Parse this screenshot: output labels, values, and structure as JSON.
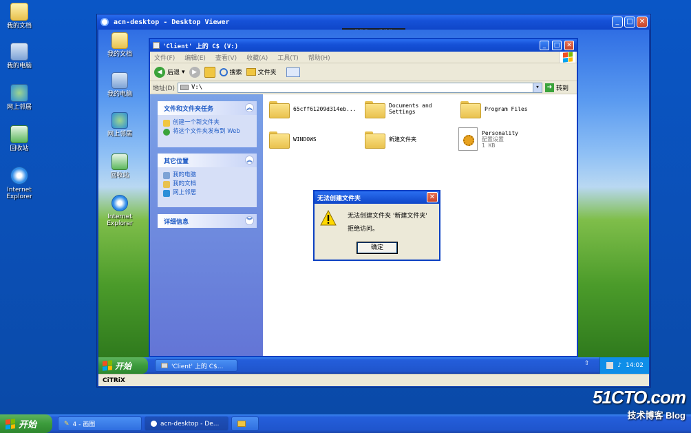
{
  "outer_desktop": {
    "icons": [
      {
        "label": "我的文档",
        "icon": "my-documents-icon"
      },
      {
        "label": "我的电脑",
        "icon": "my-computer-icon"
      },
      {
        "label": "网上邻居",
        "icon": "network-places-icon"
      },
      {
        "label": "回收站",
        "icon": "recycle-bin-icon"
      },
      {
        "label": "Internet Explorer",
        "icon": "internet-explorer-icon"
      }
    ]
  },
  "outer_taskbar": {
    "start_label": "开始",
    "tasks": [
      "4 - 画图",
      "acn-desktop - De..."
    ],
    "colors": {
      "taskbar": "#245edb",
      "start": "#3c9b3c"
    }
  },
  "viewer": {
    "title": "acn-desktop - Desktop Viewer",
    "handle_label": "⠿⠿⠿ ↓ ⠿⠿⠿",
    "buttons": {
      "minimize": "_",
      "maximize": "□",
      "close": "✕"
    }
  },
  "inner_desktop": {
    "icons": [
      {
        "label": "我的文档",
        "icon": "my-documents-icon"
      },
      {
        "label": "我的电脑",
        "icon": "my-computer-icon"
      },
      {
        "label": "网上邻居",
        "icon": "network-places-icon"
      },
      {
        "label": "回收站",
        "icon": "recycle-bin-icon"
      },
      {
        "label": "Internet Explorer",
        "icon": "internet-explorer-icon"
      }
    ]
  },
  "explorer": {
    "title": "'Client' 上的 C$ (V:)",
    "menus": [
      "文件(F)",
      "编辑(E)",
      "查看(V)",
      "收藏(A)",
      "工具(T)",
      "帮助(H)"
    ],
    "toolbar": {
      "back": "后退",
      "search": "搜索",
      "folders": "文件夹"
    },
    "address": {
      "label": "地址(D)",
      "value": "V:\\",
      "go": "转到"
    },
    "task_pane": {
      "file_tasks": {
        "title": "文件和文件夹任务",
        "links": [
          "创建一个新文件夹",
          "将这个文件夹发布到 Web"
        ]
      },
      "other_places": {
        "title": "其它位置",
        "links": [
          "我的电脑",
          "我的文档",
          "网上邻居"
        ]
      },
      "details": {
        "title": "详细信息"
      }
    },
    "files": [
      {
        "name": "65cff61209d314eb...",
        "type": "folder"
      },
      {
        "name": "Documents and Settings",
        "type": "folder"
      },
      {
        "name": "Program Files",
        "type": "folder"
      },
      {
        "name": "WINDOWS",
        "type": "folder"
      },
      {
        "name": "新建文件夹",
        "type": "folder"
      },
      {
        "name": "Personality",
        "sub1": "配置设置",
        "sub2": "1 KB",
        "type": "config"
      }
    ]
  },
  "dialog": {
    "title": "无法创建文件夹",
    "message_line1": "无法创建文件夹 '新建文件夹'",
    "message_line2": "拒绝访问。",
    "ok_label": "确定"
  },
  "inner_taskbar": {
    "start_label": "开始",
    "task": "'Client' 上的 C$...",
    "clock": "14:02"
  },
  "citrix_label": "CiTRiX",
  "watermark": {
    "line1": "51CTO.com",
    "line2": "技术博客",
    "line3": "Blog"
  }
}
